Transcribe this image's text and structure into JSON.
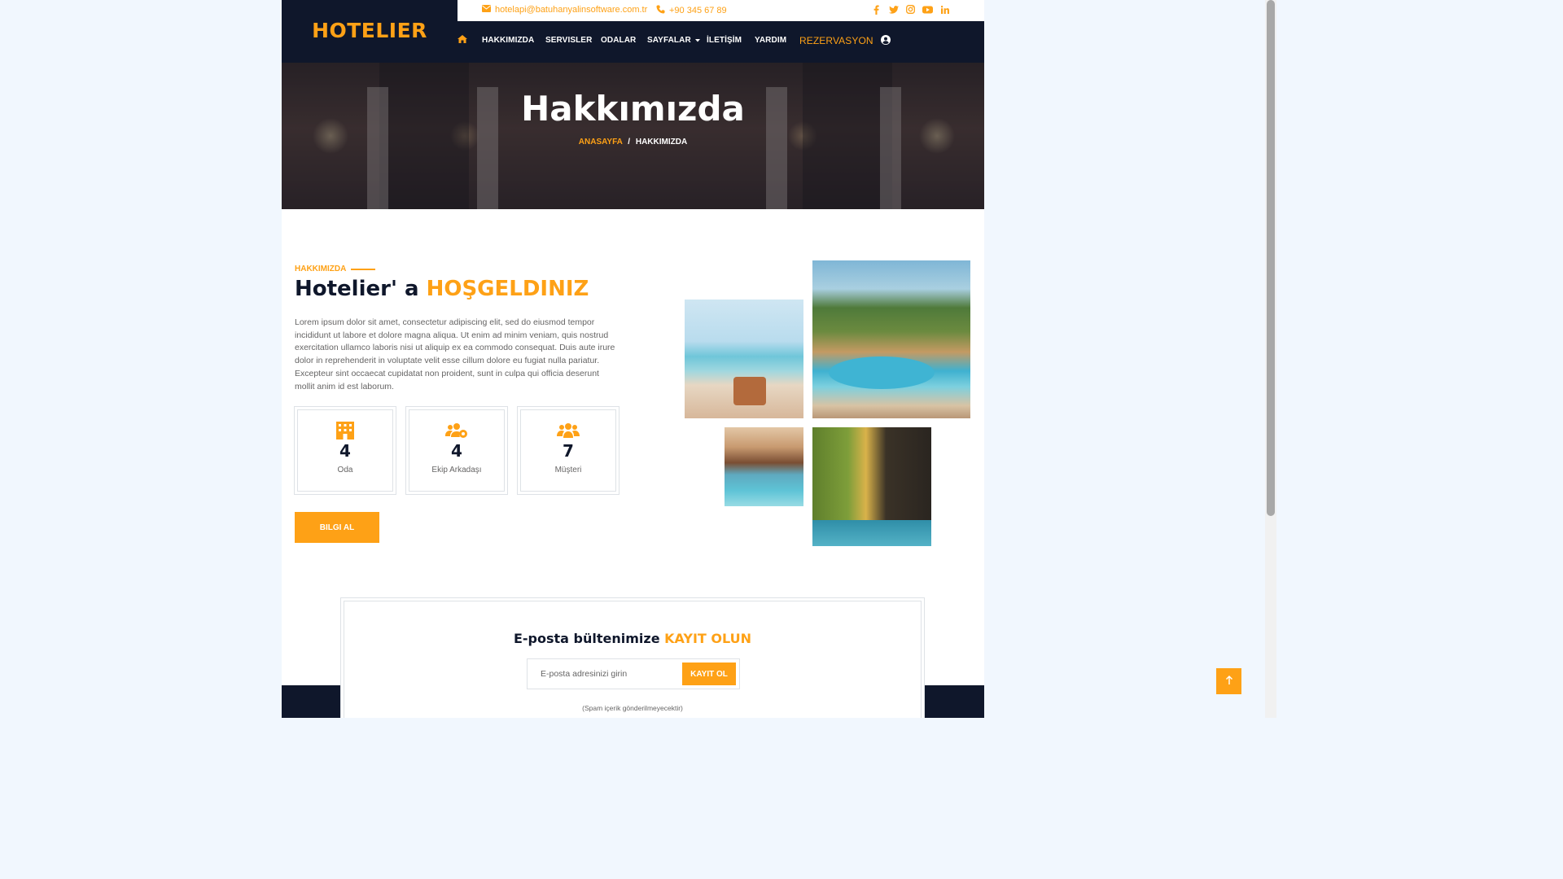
{
  "brand": {
    "name": "HOTELIER"
  },
  "topbar": {
    "email": "hotelapi@batuhanyalinsoftware.com.tr",
    "phone": "+90 345 67 89",
    "socials": [
      "facebook-icon",
      "twitter-icon",
      "instagram-icon",
      "youtube-icon",
      "linkedin-icon"
    ]
  },
  "nav": {
    "items": [
      {
        "label": "HAKKIMIZDA"
      },
      {
        "label": "SERVISLER"
      },
      {
        "label": "ODALAR"
      },
      {
        "label": "SAYFALAR"
      },
      {
        "label": "İLETİŞİM"
      },
      {
        "label": "YARDIM"
      }
    ],
    "reserve": "REZERVASYON"
  },
  "hero": {
    "title": "Hakkımızda",
    "breadcrumb_home": "ANASAYFA",
    "breadcrumb_sep": "/",
    "breadcrumb_current": "HAKKIMIZDA"
  },
  "about": {
    "label": "HAKKIMIZDA",
    "title_prefix": "Hotelier' a ",
    "title_accent": "HOŞGELDINIZ",
    "text": "Lorem ipsum dolor sit amet, consectetur adipiscing elit, sed do eiusmod tempor incididunt ut labore et dolore magna aliqua. Ut enim ad minim veniam, quis nostrud exercitation ullamco laboris nisi ut aliquip ex ea commodo consequat. Duis aute irure dolor in reprehenderit in voluptate velit esse cillum dolore eu fugiat nulla pariatur. Excepteur sint occaecat cupidatat non proident, sunt in culpa qui officia deserunt mollit anim id est laborum.",
    "stats": [
      {
        "value": "4",
        "label": "Oda",
        "icon": "hotel-icon"
      },
      {
        "value": "4",
        "label": "Ekip Arkadaşı",
        "icon": "users-cog-icon"
      },
      {
        "value": "7",
        "label": "Müşteri",
        "icon": "users-icon"
      }
    ],
    "button": "BILGI AL"
  },
  "newsletter": {
    "title_prefix": "E-posta bültenimize ",
    "title_accent": "KAYIT OLUN",
    "placeholder": "E-posta adresinizi girin",
    "button": "KAYIT OL",
    "note": "(Spam içerik gönderilmeyecektir)"
  },
  "colors": {
    "primary": "#fea116",
    "dark": "#0f172b",
    "text": "#666565",
    "page_bg": "#f1f7fe"
  }
}
